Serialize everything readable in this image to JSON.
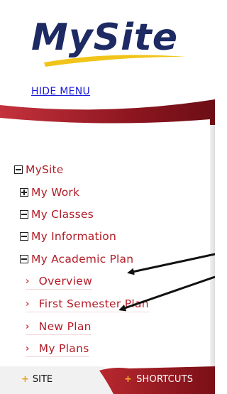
{
  "logo": {
    "text": "MySite"
  },
  "hide_menu_label": "HIDE MENU",
  "tree": {
    "root": {
      "label": "MySite",
      "icon": "minus-box-icon"
    },
    "items": [
      {
        "label": "My Work",
        "icon": "plus-box-icon"
      },
      {
        "label": "My Classes",
        "icon": "minus-box-icon"
      },
      {
        "label": "My Information",
        "icon": "minus-box-icon"
      },
      {
        "label": "My Academic Plan",
        "icon": "minus-box-icon"
      }
    ],
    "sub_items": [
      {
        "label": "Overview"
      },
      {
        "label": "First Semester Plan"
      },
      {
        "label": "New Plan"
      },
      {
        "label": "My Plans"
      }
    ]
  },
  "tabs": {
    "site": {
      "label": "SITE",
      "marker": "+"
    },
    "shortcuts": {
      "label": "SHORTCUTS",
      "marker": "+"
    }
  },
  "colors": {
    "brand_navy": "#1d2a63",
    "brand_gold": "#f0c419",
    "menu_red": "#b21b26",
    "link_blue": "#1a1adb",
    "swoosh_dark": "#7d1119"
  }
}
